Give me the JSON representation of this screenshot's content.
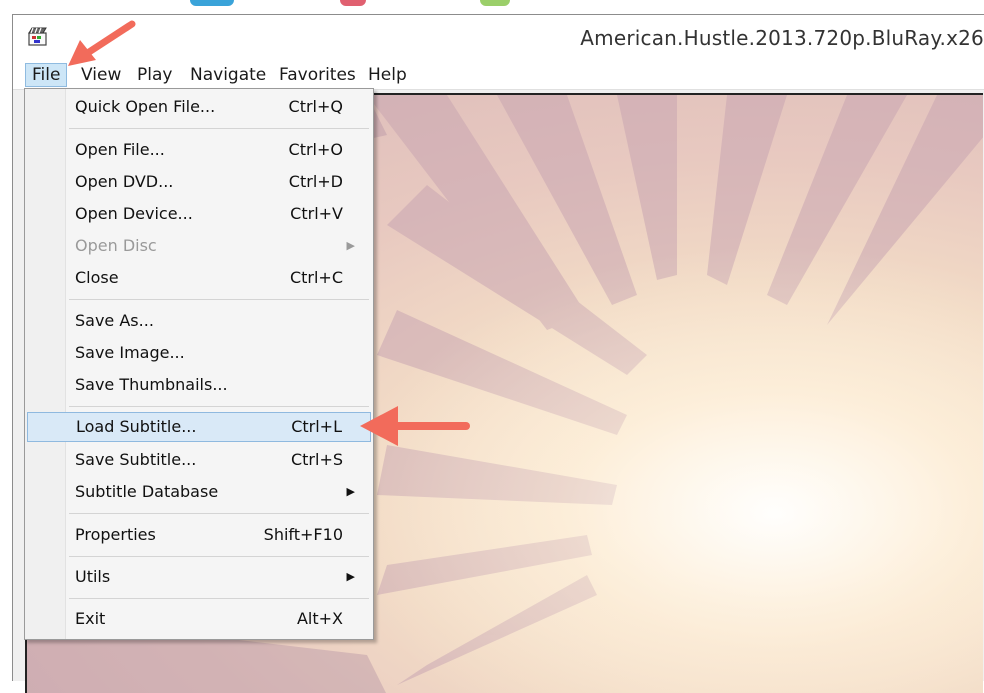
{
  "window": {
    "title": "American.Hustle.2013.720p.BluRay.x26"
  },
  "menubar": {
    "items": [
      {
        "label": "File"
      },
      {
        "label": "View"
      },
      {
        "label": "Play"
      },
      {
        "label": "Navigate"
      },
      {
        "label": "Favorites"
      },
      {
        "label": "Help"
      }
    ]
  },
  "file_menu": {
    "items": [
      {
        "label": "Quick Open File...",
        "shortcut": "Ctrl+Q"
      },
      {
        "label": "Open File...",
        "shortcut": "Ctrl+O"
      },
      {
        "label": "Open DVD...",
        "shortcut": "Ctrl+D"
      },
      {
        "label": "Open Device...",
        "shortcut": "Ctrl+V"
      },
      {
        "label": "Open Disc",
        "shortcut": "",
        "submenu": true,
        "disabled": true
      },
      {
        "label": "Close",
        "shortcut": "Ctrl+C"
      },
      {
        "label": "Save As...",
        "shortcut": ""
      },
      {
        "label": "Save Image...",
        "shortcut": ""
      },
      {
        "label": "Save Thumbnails...",
        "shortcut": ""
      },
      {
        "label": "Load Subtitle...",
        "shortcut": "Ctrl+L",
        "highlighted": true
      },
      {
        "label": "Save Subtitle...",
        "shortcut": "Ctrl+S"
      },
      {
        "label": "Subtitle Database",
        "shortcut": "",
        "submenu": true
      },
      {
        "label": "Properties",
        "shortcut": "Shift+F10"
      },
      {
        "label": "Utils",
        "shortcut": "",
        "submenu": true
      },
      {
        "label": "Exit",
        "shortcut": "Alt+X"
      }
    ]
  },
  "icons": {
    "app": "app-clapper-icon",
    "submenu": "chevron-right-icon",
    "annotation": "red-arrow-pointer-icon"
  },
  "colors": {
    "menu_highlight": "#d9e9f7",
    "menu_highlight_border": "#8fb9df",
    "annotation_arrow": "#f26b5b"
  }
}
